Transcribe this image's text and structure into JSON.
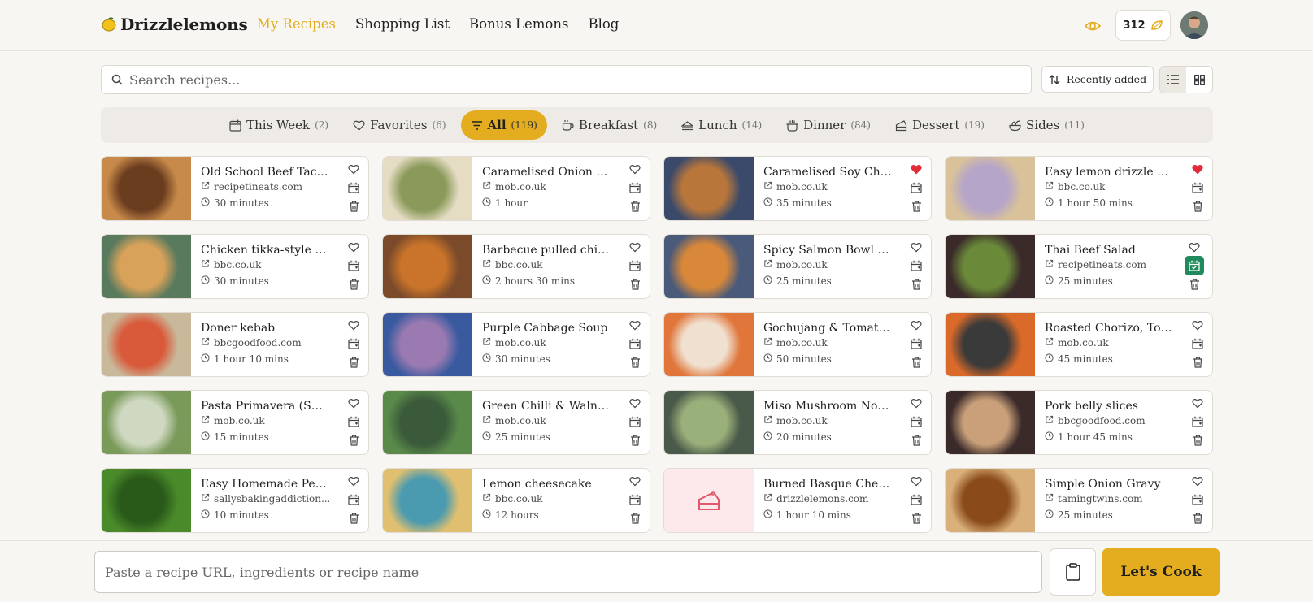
{
  "header": {
    "brand": "Drizzlelemons",
    "nav": [
      {
        "label": "My Recipes",
        "active": true
      },
      {
        "label": "Shopping List"
      },
      {
        "label": "Bonus Lemons"
      },
      {
        "label": "Blog"
      }
    ],
    "credits": "312",
    "accent_color": "#e3ad1f"
  },
  "search": {
    "placeholder": "Search recipes..."
  },
  "sort": {
    "label": "Recently added"
  },
  "tabs": [
    {
      "label": "This Week",
      "count": "(2)",
      "icon": "calendar-icon"
    },
    {
      "label": "Favorites",
      "count": "(6)",
      "icon": "heart-icon"
    },
    {
      "label": "All",
      "count": "(119)",
      "icon": "filter-icon",
      "active": true
    },
    {
      "label": "Breakfast",
      "count": "(8)",
      "icon": "coffee-cup-icon"
    },
    {
      "label": "Lunch",
      "count": "(14)",
      "icon": "sandwich-icon"
    },
    {
      "label": "Dinner",
      "count": "(84)",
      "icon": "cooking-pot-icon"
    },
    {
      "label": "Dessert",
      "count": "(19)",
      "icon": "cake-slice-icon"
    },
    {
      "label": "Sides",
      "count": "(11)",
      "icon": "salad-icon"
    }
  ],
  "recipes": [
    {
      "title": "Old School Beef Taco r...",
      "source": "recipetineats.com",
      "time": "30 minutes",
      "fav": false,
      "scheduled": false
    },
    {
      "title": "Caramelised Onion & L...",
      "source": "mob.co.uk",
      "time": "1 hour",
      "fav": false,
      "scheduled": false
    },
    {
      "title": "Caramelised Soy Chick...",
      "source": "mob.co.uk",
      "time": "35 minutes",
      "fav": true,
      "scheduled": false
    },
    {
      "title": "Easy lemon drizzle cake",
      "source": "bbc.co.uk",
      "time": "1 hour 50 mins",
      "fav": true,
      "scheduled": false
    },
    {
      "title": "Chicken tikka-style sa...",
      "source": "bbc.co.uk",
      "time": "30 minutes",
      "fav": false,
      "scheduled": false
    },
    {
      "title": "Barbecue pulled chick...",
      "source": "bbc.co.uk",
      "time": "2 hours 30 mins",
      "fav": false,
      "scheduled": false
    },
    {
      "title": "Spicy Salmon Bowl wit...",
      "source": "mob.co.uk",
      "time": "25 minutes",
      "fav": false,
      "scheduled": false
    },
    {
      "title": "Thai Beef Salad",
      "source": "recipetineats.com",
      "time": "25 minutes",
      "fav": false,
      "scheduled": true
    },
    {
      "title": "Doner kebab",
      "source": "bbcgoodfood.com",
      "time": "1 hour 10 mins",
      "fav": false,
      "scheduled": false
    },
    {
      "title": "Purple Cabbage Soup",
      "source": "mob.co.uk",
      "time": "30 minutes",
      "fav": false,
      "scheduled": false
    },
    {
      "title": "Gochujang & Tomato S...",
      "source": "mob.co.uk",
      "time": "50 minutes",
      "fav": false,
      "scheduled": false
    },
    {
      "title": "Roasted Chorizo, Toma...",
      "source": "mob.co.uk",
      "time": "45 minutes",
      "fav": false,
      "scheduled": false
    },
    {
      "title": "Pasta Primavera (Sprin...",
      "source": "mob.co.uk",
      "time": "15 minutes",
      "fav": false,
      "scheduled": false
    },
    {
      "title": "Green Chilli & Walnut ...",
      "source": "mob.co.uk",
      "time": "25 minutes",
      "fav": false,
      "scheduled": false
    },
    {
      "title": "Miso Mushroom Noodl...",
      "source": "mob.co.uk",
      "time": "20 minutes",
      "fav": false,
      "scheduled": false
    },
    {
      "title": "Pork belly slices",
      "source": "bbcgoodfood.com",
      "time": "1 hour 45 mins",
      "fav": false,
      "scheduled": false
    },
    {
      "title": "Easy Homemade Pesto...",
      "source": "sallysbakingaddiction....",
      "time": "10 minutes",
      "fav": false,
      "scheduled": false
    },
    {
      "title": "Lemon cheesecake",
      "source": "bbc.co.uk",
      "time": "12 hours",
      "fav": false,
      "scheduled": false
    },
    {
      "title": "Burned Basque Cheese...",
      "source": "drizzlelemons.com",
      "time": "1 hour 10 mins",
      "fav": false,
      "scheduled": false
    },
    {
      "title": "Simple Onion Gravy",
      "source": "tamingtwins.com",
      "time": "25 minutes",
      "fav": false,
      "scheduled": false
    }
  ],
  "composer": {
    "placeholder": "Paste a recipe URL, ingredients or recipe name",
    "submit": "Let's Cook"
  }
}
